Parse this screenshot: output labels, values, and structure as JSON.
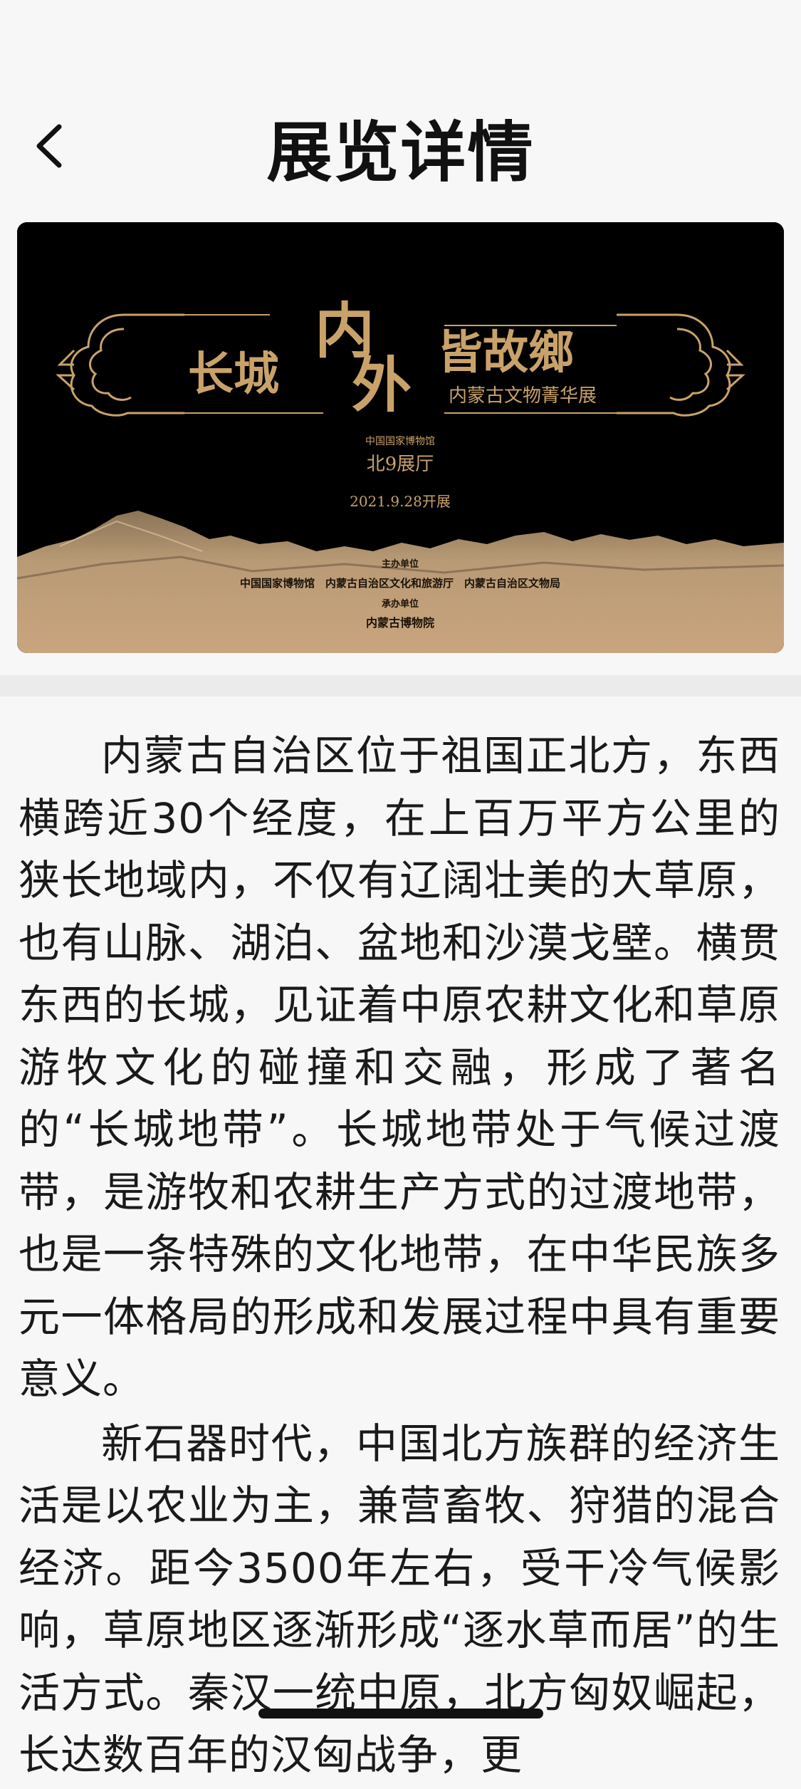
{
  "header": {
    "title": "展览详情",
    "back_icon": "chevron-left-icon"
  },
  "banner": {
    "title_left": "长城",
    "title_center_1": "内",
    "title_center_2": "外",
    "title_right": "皆故鄉",
    "subtitle": "内蒙古文物菁华展",
    "venue_museum": "中国国家博物馆",
    "venue_hall": "北9展厅",
    "open_date": "2021.9.28开展",
    "host_label": "主办单位",
    "host_units": "中国国家博物馆　内蒙古自治区文化和旅游厅　内蒙古自治区文物局",
    "organizer_label": "承办单位",
    "organizer_unit": "内蒙古博物院",
    "colors": {
      "background": "#000000",
      "gold": "#c9a26a",
      "mountain": "#b89a75"
    }
  },
  "article": {
    "paragraphs": [
      "内蒙古自治区位于祖国正北方，东西横跨近30个经度，在上百万平方公里的狭长地域内，不仅有辽阔壮美的大草原，也有山脉、湖泊、盆地和沙漠戈壁。横贯东西的长城，见证着中原农耕文化和草原游牧文化的碰撞和交融，形成了著名的“长城地带”。长城地带处于气候过渡带，是游牧和农耕生产方式的过渡地带，也是一条特殊的文化地带，在中华民族多元一体格局的形成和发展过程中具有重要意义。",
      "新石器时代，中国北方族群的经济生活是以农业为主，兼营畜牧、狩猎的混合经济。距今3500年左右，受干冷气候影响，草原地区逐渐形成“逐水草而居”的生活方式。秦汉一统中原，北方匈奴崛起，长达数百年的汉匈战争，更"
    ]
  }
}
